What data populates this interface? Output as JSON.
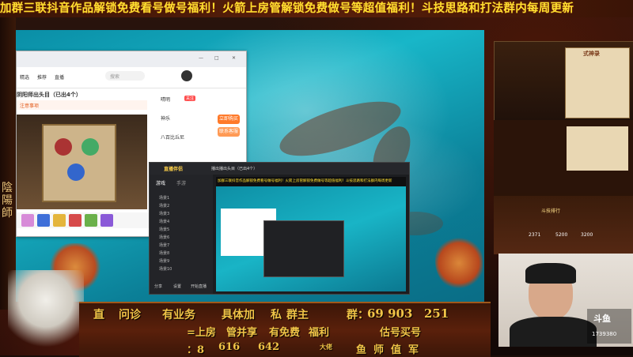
{
  "marquee": "加群三联抖音作品解锁免费看号做号福利！火箭上房管解锁免费做号等超值福利！斗技思路和打法群内每周更新",
  "left_deco": "陰陽師",
  "browser": {
    "tabs": [
      "精选",
      "推荐",
      "直播"
    ],
    "title": "阴阳师出头目（已出4个）",
    "search_placeholder": "搜索",
    "notice": "注意事项",
    "buttons": [
      "立即购买",
      "联系客服"
    ],
    "follow_label": "关注",
    "items": [
      "晴明",
      "神乐",
      "八百比丘尼"
    ],
    "window_controls": [
      "—",
      "□",
      "✕"
    ]
  },
  "app": {
    "logo": "直播伴侣",
    "tabs": [
      "游戏",
      "手游"
    ],
    "title": "播出播出头目（已出4个）",
    "sidebar_items": [
      "场景1",
      "场景2",
      "场景3",
      "场景4",
      "场景5",
      "场景6",
      "场景7",
      "场景8",
      "场景9",
      "场景10"
    ],
    "marquee_preview": "加群三联抖音作品解锁免费看号做号福利！火箭上房管解锁免费做号等超值福利！斗技思路和打法群内每周更新",
    "bottom_buttons": [
      "分享",
      "设置",
      "开始直播"
    ]
  },
  "right_panel": {
    "title": "式神录",
    "stats": [
      "2371",
      "5200",
      "3200"
    ],
    "event": "斗技排行"
  },
  "banner": {
    "line1": [
      "直",
      "问诊",
      "有业务",
      "具体加",
      "私",
      "群主",
      "群：",
      "69 903",
      "251"
    ],
    "line2": [
      "=上房",
      "管并享",
      "有免费",
      "福利",
      "估号买号"
    ],
    "line3": [
      "：8",
      "616",
      "642",
      "大佬",
      "鱼",
      "师",
      "值",
      "军"
    ]
  },
  "watermark": {
    "platform": "斗鱼",
    "room_id": "1739380"
  },
  "colors": {
    "marquee": "#ffe030",
    "banner_text": "#f1c447",
    "ocean": "#18b6c8",
    "accent_orange": "#ff7a2a"
  }
}
